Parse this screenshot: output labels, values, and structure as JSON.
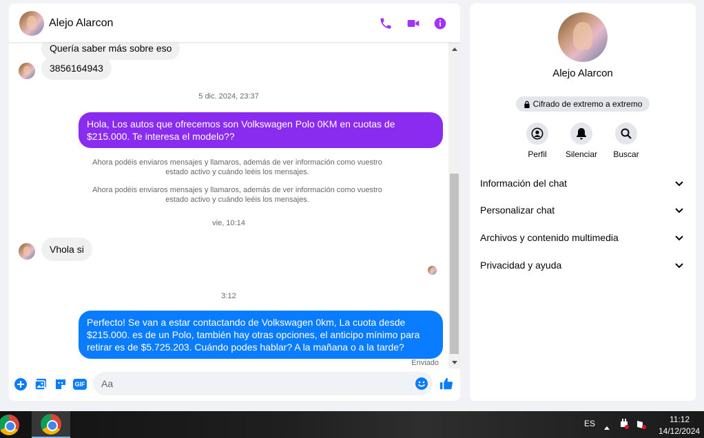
{
  "chat": {
    "contact_name": "Alejo Alarcon",
    "messages": {
      "partial_incoming": "Quería saber más sobre eso",
      "phone_number": "3856164943",
      "stamp_1": "5 dic. 2024, 23:37",
      "outgoing_1": "Hola, Los autos que ofrecemos son Volkswagen Polo 0KM en cuotas de $215.000. Te interesa el modelo??",
      "system_note_1": "Ahora podéis enviaros mensajes y llamaros, además de ver información como vuestro estado activo y cuándo leéis los mensajes.",
      "system_note_2": "Ahora podéis enviaros mensajes y llamaros, además de ver información como vuestro estado activo y cuándo leéis los mensajes.",
      "stamp_2": "vie, 10:14",
      "incoming_2": "Vhola si",
      "stamp_3": "3:12",
      "outgoing_2": "Perfecto!  Se van a estar contactando de Volkswagen 0km, La cuota desde $215.000. es de un Polo, también hay otras opciones, el anticipo mínimo para retirar es de $5.725.203. Cuándo podes hablar? A la mañana o a la tarde?",
      "sent_status": "Enviado"
    },
    "composer": {
      "placeholder": "Aa",
      "gif_label": "GIF"
    }
  },
  "info": {
    "name": "Alejo Alarcon",
    "encryption_badge": "Cifrado de extremo a extremo",
    "actions": {
      "profile": "Perfil",
      "mute": "Silenciar",
      "search": "Buscar"
    },
    "sections": {
      "chat_info": "Información del chat",
      "customize": "Personalizar chat",
      "files": "Archivos y contenido multimedia",
      "privacy": "Privacidad y ayuda"
    }
  },
  "taskbar": {
    "language": "ES",
    "time": "11:12",
    "date": "14/12/2024"
  },
  "colors": {
    "accent_purple": "#a033ff",
    "bubble_purple": "#8a2cf0",
    "bubble_blue": "#0a7cff",
    "like_blue": "#0a7cff"
  }
}
